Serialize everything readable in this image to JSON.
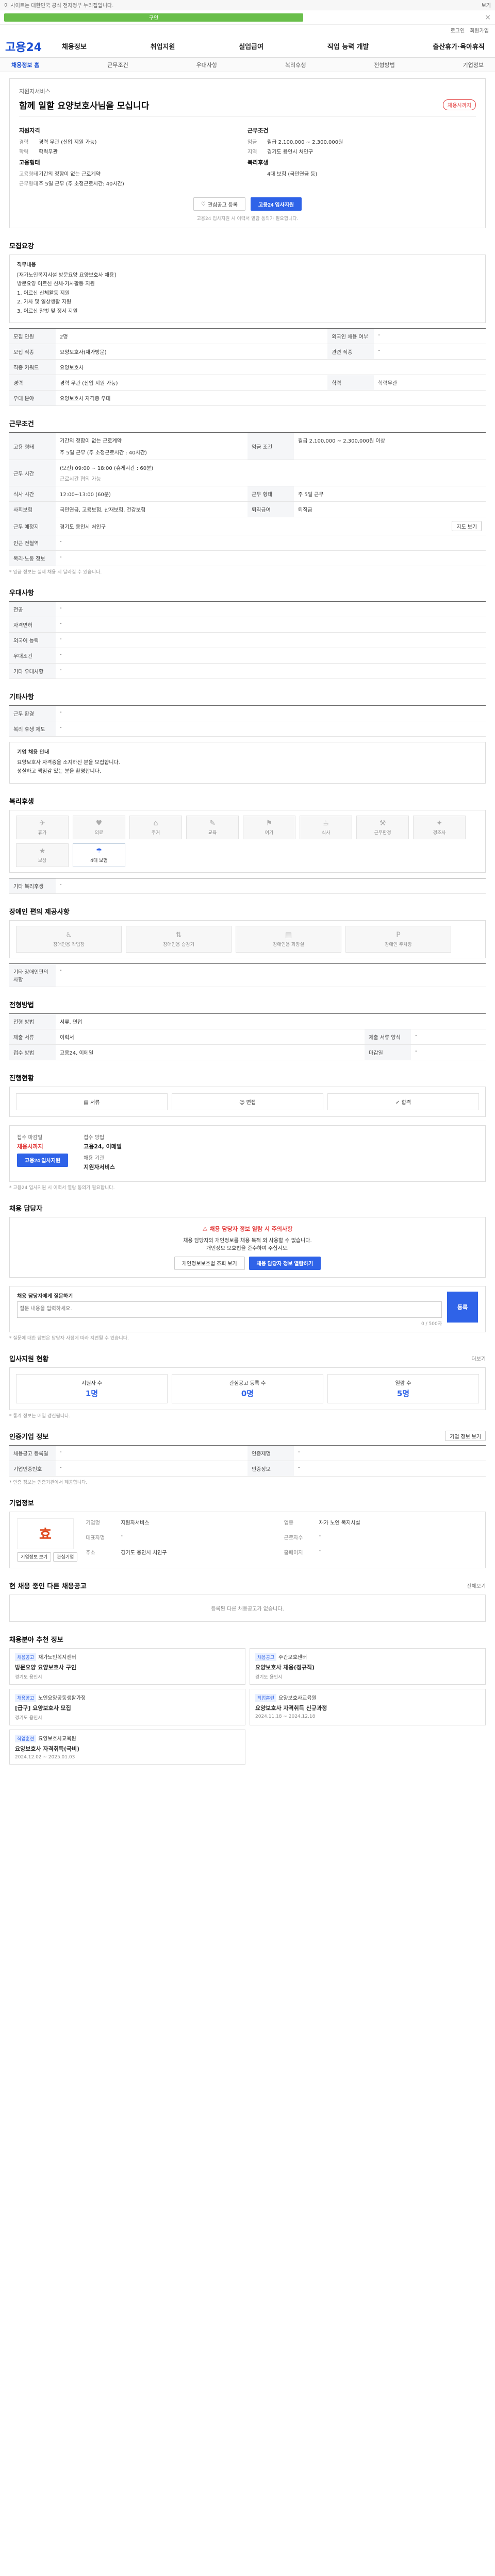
{
  "top": {
    "left": "이 사이트는 대한민국 공식 전자정부 누리집입니다.",
    "right": "보기"
  },
  "promo": {
    "text": "구인",
    "close": "×"
  },
  "util": [
    "로그인",
    "회원가입"
  ],
  "logo": "고용24",
  "gnb": [
    "채용정보",
    "취업지원",
    "실업급여",
    "직업 능력 개발",
    "출산휴가·육아휴직"
  ],
  "lnb": [
    "채용정보 홈",
    "근무조건",
    "우대사항",
    "복리후생",
    "전형방법",
    "기업정보"
  ],
  "job": {
    "org": "지원자서비스",
    "title": "함께 일할 요양보호사님을 모십니다",
    "dday": "채용시까지",
    "left_title": "지원자격",
    "left": [
      {
        "k": "경력",
        "v": "경력 무관 (신입 지원 가능)"
      },
      {
        "k": "학력",
        "v": "학력무관"
      }
    ],
    "left2_title": "고용형태",
    "left2": [
      {
        "k": "고용형태",
        "v": "기간의 정함이 없는 근로계약"
      },
      {
        "k": "근무형태",
        "v": "주 5일 근무 (주 소정근로시간: 40시간)"
      }
    ],
    "right_title": "근무조건",
    "right": [
      {
        "k": "임금",
        "v": "월급 2,100,000 ~ 2,300,000원"
      },
      {
        "k": "지역",
        "v": "경기도 용인시 처인구"
      }
    ],
    "right2_title": "복리후생",
    "right2": [
      {
        "k": "",
        "v": "4대 보험 (국민연금 등)"
      }
    ],
    "btn_save": "관심공고 등록",
    "btn_apply": "고용24 입사지원",
    "note": "고용24 입사지원 시 이력서 열람 동의가 필요합니다."
  },
  "recruit": {
    "title": "모집요강",
    "box_title": "직무내용",
    "lines": [
      "[재가노인복지시설 방문요양 요양보호사 채용]",
      "방문요양 어르신 신체·가사활동 지원",
      "",
      "1. 어르신 신체활동 지원",
      "2. 가사 및 일상생활 지원",
      "3. 어르신 말벗 및 정서 지원"
    ],
    "rows": [
      {
        "k": "모집 인원",
        "v": "2명",
        "k2": "외국인 채용 여부",
        "v2": "-"
      },
      {
        "k": "모집 직종",
        "v": "요양보호사(재가방문)",
        "k2": "관련 직종",
        "v2": "-"
      },
      {
        "k": "직종 키워드",
        "v": "요양보호사",
        "k2": "",
        "v2": ""
      },
      {
        "k": "경력",
        "v": "경력 무관 (신입 지원 가능)",
        "k2": "학력",
        "v2": "학력무관"
      },
      {
        "k": "우대 분야",
        "v": "요양보호사 자격증 우대",
        "k2": "",
        "v2": ""
      }
    ]
  },
  "work": {
    "title": "근무조건",
    "r1k": "고용 형태",
    "r1v": "기간의 정함이 없는 근로계약",
    "r1k2": "임금 조건",
    "r1v2": "월급 2,100,000 ~ 2,300,000원 이상",
    "r2k": "",
    "r2v": "주 5일 근무 (주 소정근로시간 : 40시간)",
    "r3k": "근무 시간",
    "r3v": "(오전) 09:00 ~ 18:00 (휴게시간 : 60분)",
    "r3note": "근로시간 협의 가능",
    "r4k": "식사 시간",
    "r4v": "12:00~13:00 (60분)",
    "r4k2": "근무 형태",
    "r4v2": "주 5일 근무",
    "r5k": "사회보험",
    "r5v": "국민연금, 고용보험, 산재보험, 건강보험",
    "r5k2": "퇴직급여",
    "r5v2": "퇴직금",
    "r6k": "근무 예정지",
    "r6v": "경기도 용인시 처인구",
    "r6btn": "지도 보기",
    "r7k": "인근 전철역",
    "r7v": "-",
    "r8k": "복리·노동 정보",
    "r8v": "-",
    "footnote": "* 임금 정보는 실제 채용 시 달라질 수 있습니다."
  },
  "pref": {
    "title": "우대사항",
    "rows": [
      {
        "k": "전공",
        "v": "-"
      },
      {
        "k": "자격면허",
        "v": "-"
      },
      {
        "k": "외국어 능력",
        "v": "-"
      },
      {
        "k": "우대조건",
        "v": "-"
      },
      {
        "k": "기타 우대사항",
        "v": "-"
      }
    ]
  },
  "etc": {
    "title": "기타사항",
    "rows": [
      {
        "k": "근무 환경",
        "v": "-"
      },
      {
        "k": "복리 후생 제도",
        "v": "-"
      }
    ],
    "box_title": "기업 채용 안내",
    "lines": [
      "요양보호사 자격증을 소지하신 분을 모집합니다.",
      "성실하고 책임감 있는 분을 환영합니다."
    ]
  },
  "welfare": {
    "title": "복리후생",
    "items": [
      {
        "ic": "✈",
        "label": "휴가",
        "on": false
      },
      {
        "ic": "♥",
        "label": "의료",
        "on": false
      },
      {
        "ic": "⌂",
        "label": "주거",
        "on": false
      },
      {
        "ic": "✎",
        "label": "교육",
        "on": false
      },
      {
        "ic": "⚑",
        "label": "여가",
        "on": false
      },
      {
        "ic": "☕",
        "label": "식사",
        "on": false
      },
      {
        "ic": "⚒",
        "label": "근무환경",
        "on": false
      },
      {
        "ic": "✦",
        "label": "경조사",
        "on": false
      },
      {
        "ic": "★",
        "label": "보상",
        "on": false
      },
      {
        "ic": "☂",
        "label": "4대 보험",
        "on": true
      }
    ],
    "other_k": "기타 복리후생",
    "other_v": "-"
  },
  "disabled": {
    "title": "장애인 편의 제공사항",
    "items": [
      {
        "ic": "♿",
        "label": "장애인용 작업장"
      },
      {
        "ic": "⇅",
        "label": "장애인용 승강기"
      },
      {
        "ic": "▦",
        "label": "장애인용 화장실"
      },
      {
        "ic": "P",
        "label": "장애인 주차장"
      }
    ],
    "other_k": "기타 장애인편의사항",
    "other_v": "-"
  },
  "process": {
    "title": "전형방법",
    "rows": [
      {
        "k": "전형 방법",
        "v": "서류, 면접",
        "k2": "",
        "v2": ""
      },
      {
        "k": "제출 서류",
        "v": "이력서",
        "k2": "제출 서류 양식",
        "v2": "-"
      },
      {
        "k": "접수 방법",
        "v": "고용24, 이메일",
        "k2": "마감일",
        "v2": "-"
      }
    ]
  },
  "status": {
    "title": "진행현황",
    "steps": [
      "서류",
      "면접",
      "합격"
    ]
  },
  "apply": {
    "a_label": "접수 마감일",
    "a_value": "채용시까지",
    "b_label": "접수 방법",
    "b_value": "고용24, 이메일",
    "c_label": "채용 기관",
    "c_value": "지원자서비스",
    "btn": "고용24 입사지원",
    "notes": [
      "* 고용24 입사지원 시 이력서 열람 동의가 필요합니다."
    ]
  },
  "warning": {
    "title": "채용 담당자",
    "h": "채용 담당자 정보 열람 시 주의사항",
    "p1": "채용 담당자의 개인정보를 채용 목적 외 사용할 수 없습니다.",
    "p2": "개인정보 보호법을 준수하여 주십시오.",
    "btn1": "개인정보보호법 조회 보기",
    "btn2": "채용 담당자 정보 열람하기"
  },
  "inquiry": {
    "title": "채용 담당자에게 질문하기",
    "placeholder": "질문 내용을 입력하세요.",
    "count": "0 / 500자",
    "btn": "등록",
    "notes": [
      "* 질문에 대한 답변은 담당자 사정에 따라 지연될 수 있습니다."
    ]
  },
  "stats": {
    "title": "입사지원 현황",
    "more": "더보기",
    "items": [
      {
        "label": "지원자 수",
        "n": "1명"
      },
      {
        "label": "관심공고 등록 수",
        "n": "0명"
      },
      {
        "label": "열람 수",
        "n": "5명"
      }
    ],
    "note": "* 통계 정보는 매일 갱신됩니다."
  },
  "info": {
    "title": "인증기업 정보",
    "btn": "기업 정보 보기",
    "rows": [
      {
        "k": "채용공고 등록일",
        "v": "-",
        "k2": "인증제명",
        "v2": "-"
      },
      {
        "k": "기업인증번호",
        "v": "-",
        "k2": "인증정보",
        "v2": "-"
      }
    ],
    "note": "* 인증 정보는 인증기관에서 제공합니다."
  },
  "company": {
    "title": "기업정보",
    "logo": "효",
    "btn1": "기업정보 보기",
    "btn2": "관심기업",
    "fields": [
      {
        "k": "기업명",
        "v": "지원자서비스"
      },
      {
        "k": "업종",
        "v": "재가 노인 복지시설"
      },
      {
        "k": "대표자명",
        "v": "-"
      },
      {
        "k": "근로자수",
        "v": "-"
      },
      {
        "k": "주소",
        "v": "경기도 용인시 처인구"
      },
      {
        "k": "홈페이지",
        "v": "-"
      }
    ]
  },
  "similar": {
    "title": "현 채용 중인 다른 채용공고",
    "more": "전체보기",
    "empty": "등록된 다른 채용공고가 없습니다."
  },
  "recommend": {
    "title": "채용분야 추천 정보",
    "items": [
      {
        "tag": "채용공고",
        "org": "재가노인복지센터",
        "t": "방문요양 요양보호사 구인",
        "m": "경기도 용인시"
      },
      {
        "tag": "채용공고",
        "org": "주간보호센터",
        "t": "요양보호사 채용(정규직)",
        "m": "경기도 용인시"
      },
      {
        "tag": "채용공고",
        "org": "노인요양공동생활가정",
        "t": "[급구] 요양보호사 모집",
        "m": "경기도 용인시"
      },
      {
        "tag": "직업훈련",
        "org": "요양보호사교육원",
        "t": "요양보호사 자격취득 신규과정",
        "m": "2024.11.18 ~ 2024.12.18"
      },
      {
        "tag": "직업훈련",
        "org": "요양보호사교육원",
        "t": "요양보호사 자격취득(국비)",
        "m": "2024.12.02 ~ 2025.01.03"
      }
    ]
  }
}
